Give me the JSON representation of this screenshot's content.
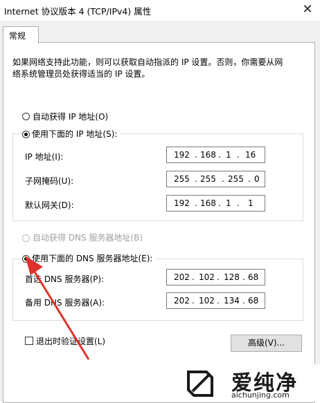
{
  "window": {
    "title": "Internet 协议版本 4 (TCP/IPv4) 属性",
    "close_icon": "close-icon"
  },
  "tab": {
    "label": "常规"
  },
  "intro": {
    "line1": "如果网络支持此功能，则可以获取自动指派的 IP 设置。否则，你需要从网",
    "line2": "络系统管理员处获得适当的 IP 设置。"
  },
  "ip_auto": {
    "label": "自动获得 IP 地址(O)",
    "selected": false
  },
  "ip_manual": {
    "label": "使用下面的 IP 地址(S):",
    "selected": true,
    "fields": [
      {
        "label": "IP 地址(I):",
        "octets": [
          "192",
          "168",
          "1",
          "16"
        ]
      },
      {
        "label": "子网掩码(U):",
        "octets": [
          "255",
          "255",
          "255",
          "0"
        ]
      },
      {
        "label": "默认网关(D):",
        "octets": [
          "192",
          "168",
          "1",
          "1"
        ]
      }
    ]
  },
  "dns_auto": {
    "label": "自动获得 DNS 服务器地址(B)",
    "selected": false,
    "disabled": true
  },
  "dns_manual": {
    "label": "使用下面的 DNS 服务器地址(E):",
    "selected": true,
    "fields": [
      {
        "label": "首选 DNS 服务器(P):",
        "octets": [
          "202",
          "102",
          "128",
          "68"
        ]
      },
      {
        "label": "备用 DNS 服务器(A):",
        "octets": [
          "202",
          "102",
          "134",
          "68"
        ]
      }
    ]
  },
  "validate": {
    "label": "退出时验证设置(L)",
    "checked": false
  },
  "advanced_button": {
    "label": "高级(V)..."
  },
  "watermark": {
    "brand": "爱纯净",
    "url": "aichunjing.com",
    "color": "#1a1a1a"
  },
  "annotation": {
    "arrow_color": "#e0322b"
  }
}
